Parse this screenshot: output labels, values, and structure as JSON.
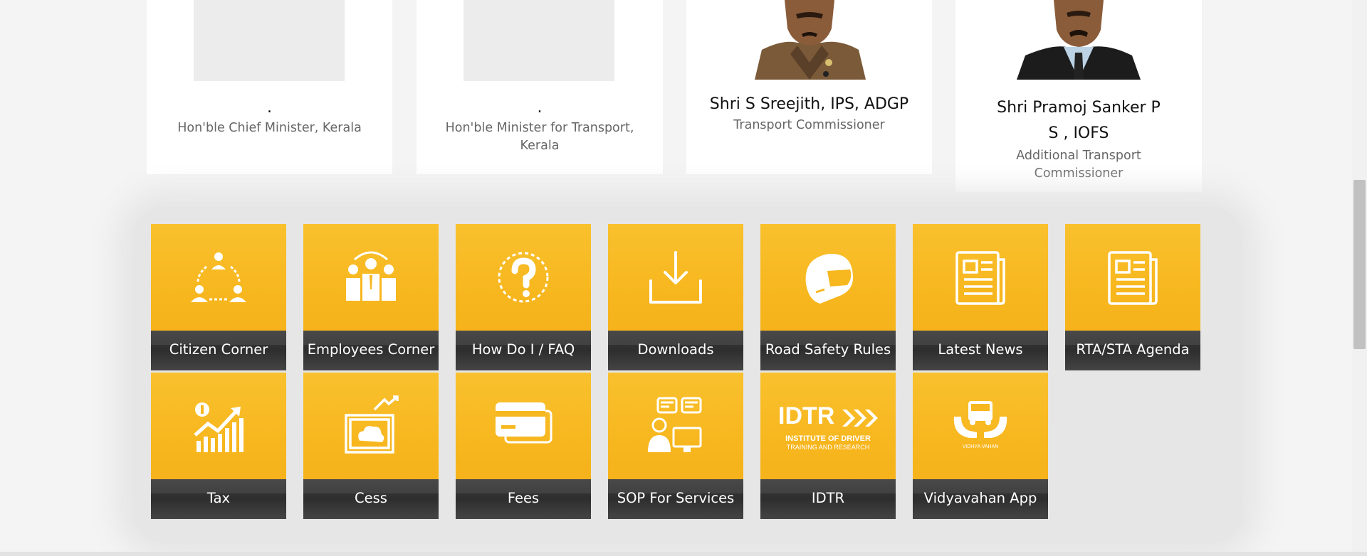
{
  "officials": [
    {
      "name": ".",
      "designation": "Hon'ble Chief Minister, Kerala"
    },
    {
      "name": ".",
      "designation": "Hon'ble Minister for Transport, Kerala"
    },
    {
      "name": "Shri S Sreejith, IPS, ADGP",
      "designation": "Transport Commissioner"
    },
    {
      "name": "Shri Pramoj Sanker P S , IOFS",
      "designation": "Additional Transport Commissioner"
    }
  ],
  "tiles": [
    {
      "label": "Citizen Corner",
      "icon": "citizen-group-icon"
    },
    {
      "label": "Employees Corner",
      "icon": "employees-group-icon"
    },
    {
      "label": "How Do I / FAQ",
      "icon": "question-icon"
    },
    {
      "label": "Downloads",
      "icon": "download-icon"
    },
    {
      "label": "Road Safety Rules",
      "icon": "helmet-icon"
    },
    {
      "label": "Latest News",
      "icon": "newspaper-icon"
    },
    {
      "label": "RTA/STA Agenda",
      "icon": "newspaper-icon"
    },
    {
      "label": "Tax",
      "icon": "tax-chart-icon"
    },
    {
      "label": "Cess",
      "icon": "cess-cloud-icon"
    },
    {
      "label": "Fees",
      "icon": "card-icon"
    },
    {
      "label": "SOP For Services",
      "icon": "sop-person-icon"
    },
    {
      "label": "IDTR",
      "icon": "idtr-logo",
      "logo_text": "IDTR",
      "logo_sub1": "INSTITUTE OF DRIVER",
      "logo_sub2": "TRAINING AND RESEARCH"
    },
    {
      "label": "Vidyavahan App",
      "icon": "vidyavahan-logo",
      "logo_text": "VIDHYA VAHAN"
    }
  ],
  "colors": {
    "tile": "#f7b71f",
    "tile_label_bg": "#333333",
    "page_bg": "#f4f4f4"
  }
}
